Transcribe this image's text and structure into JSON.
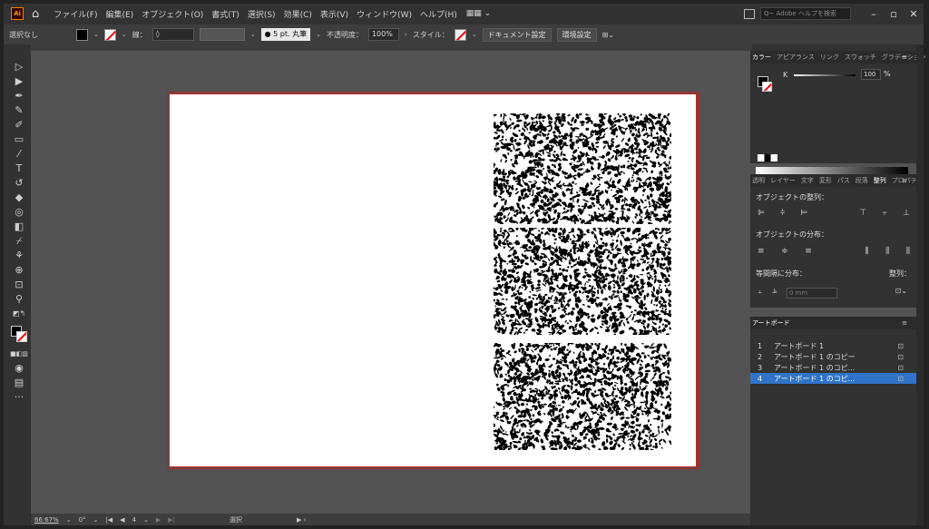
{
  "menubar": {
    "logo": "Ai",
    "items": [
      "ファイル(F)",
      "編集(E)",
      "オブジェクト(O)",
      "書式(T)",
      "選択(S)",
      "効果(C)",
      "表示(V)",
      "ウィンドウ(W)",
      "ヘルプ(H)"
    ],
    "workspace_switch": "▦▦ ⌄",
    "search_placeholder": "Q~ Adobe ヘルプを検索",
    "window_controls": [
      "–",
      "▫",
      "✕"
    ]
  },
  "controlbar": {
    "selection_label": "選択なし",
    "stroke_label": "線：",
    "brush_dropdown": "● 5 pt. 丸筆",
    "opacity_label": "不透明度：",
    "opacity_value": "100%",
    "style_label": "スタイル：",
    "doc_settings_button": "ドキュメント設定",
    "prefs_button": "環境設定"
  },
  "statusbar": {
    "zoom": "66.67%",
    "rotation": "0°",
    "artboard_number": "4",
    "tool_status": "選択"
  },
  "panels": {
    "color": {
      "tabs": [
        "カラー",
        "アピアランス",
        "リンク",
        "スウォッチ",
        "グラデーション"
      ],
      "k_label": "K",
      "k_value": "100",
      "k_unit": "%"
    },
    "align": {
      "tabs": [
        "透明",
        "レイヤー",
        "文字",
        "変形",
        "パス",
        "段落",
        "整列",
        "プロパティ"
      ],
      "active_tab": "整列",
      "align_objects_label": "オブジェクトの整列：",
      "distribute_objects_label": "オブジェクトの分布：",
      "distribute_spacing_label": "等間隔に分布：",
      "align_to_label": "整列：",
      "spacing_value": "0 mm"
    },
    "artboards": {
      "tab": "アートボード",
      "items": [
        {
          "num": "1",
          "name": "アートボード 1"
        },
        {
          "num": "2",
          "name": "アートボード 1 のコピー"
        },
        {
          "num": "3",
          "name": "アートボード 1 のコピ..."
        },
        {
          "num": "4",
          "name": "アートボード 1 のコピ..."
        }
      ],
      "selected_index": 3
    }
  },
  "colors": {
    "accent_selected": "#2f74c8",
    "artboard_outline": "#c8261e",
    "canvas_bg": "#535353"
  }
}
